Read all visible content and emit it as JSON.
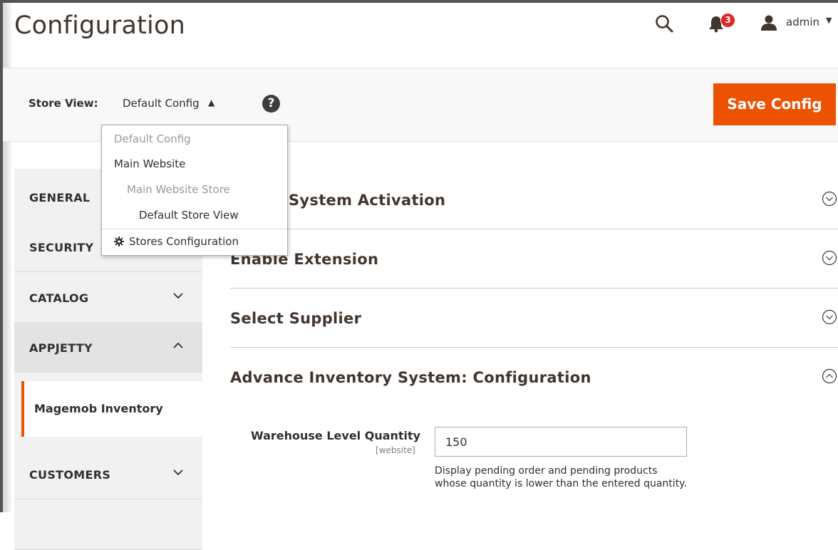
{
  "header": {
    "title": "Configuration",
    "notification_count": "3",
    "user_name": "admin"
  },
  "store_view": {
    "label": "Store View:",
    "current": "Default Config",
    "help": "?",
    "options": [
      {
        "label": "Default Config",
        "state": "disabled"
      },
      {
        "label": "Main Website",
        "state": "normal"
      },
      {
        "label": "Main Website Store",
        "state": "disabled"
      },
      {
        "label": "Default Store View",
        "state": "normal"
      }
    ],
    "stores_config_label": "Stores Configuration"
  },
  "actions": {
    "save_label": "Save Config"
  },
  "sidebar": {
    "tabs": [
      {
        "label": "GENERAL",
        "expanded": false
      },
      {
        "label": "SECURITY",
        "expanded": false
      },
      {
        "label": "CATALOG",
        "expanded": false
      },
      {
        "label": "APPJETTY",
        "expanded": true
      },
      {
        "label": "CUSTOMERS",
        "expanded": false
      }
    ],
    "active_sub_item": "Magemob Inventory"
  },
  "sections": [
    {
      "title": "Advance Inventory System Activation",
      "visible_title": "ory System Activation",
      "expanded": false
    },
    {
      "title": "Enable Extension",
      "expanded": false
    },
    {
      "title": "Select Supplier",
      "expanded": false
    },
    {
      "title": "Advance Inventory System: Configuration",
      "expanded": true
    }
  ],
  "field": {
    "label": "Warehouse Level Quantity",
    "scope": "[website]",
    "value": "150",
    "note": "Display pending order and pending products whose quantity is lower than the entered quantity."
  },
  "colors": {
    "accent": "#eb5202",
    "badge": "#e22626"
  }
}
